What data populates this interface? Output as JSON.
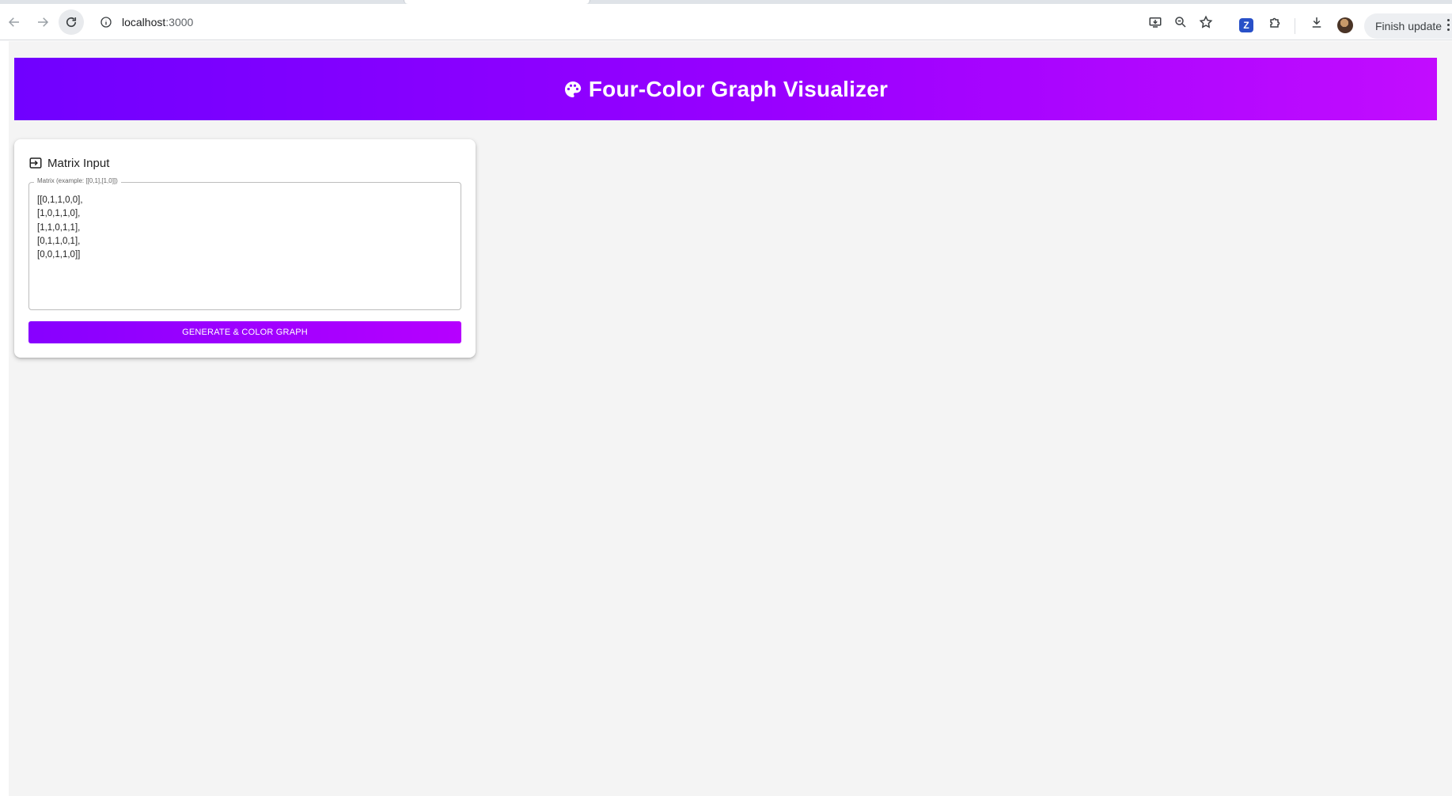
{
  "browser": {
    "url_host": "localhost",
    "url_port": ":3000",
    "finish_update_label": "Finish update"
  },
  "header": {
    "title": "Four-Color Graph Visualizer"
  },
  "matrix_card": {
    "title": "Matrix Input",
    "field_label": "Matrix (example: [[0,1],[1,0]])",
    "matrix_value": "[[0,1,1,0,0],\n[1,0,1,1,0],\n[1,1,0,1,1],\n[0,1,1,0,1],\n[0,0,1,1,0]]",
    "button_label": "GENERATE & COLOR GRAPH"
  },
  "colors": {
    "header_gradient_start": "#7000ff",
    "header_gradient_end": "#c20cff",
    "button_gradient_start": "#8700ff",
    "button_gradient_end": "#b600ff",
    "page_background": "#f4f4f4"
  },
  "icons": {
    "back": "arrow-left-icon",
    "forward": "arrow-right-icon",
    "reload": "reload-icon",
    "site_info": "info-icon",
    "install": "install-app-icon",
    "zoom": "zoom-icon",
    "bookmark": "star-icon",
    "extensions": "puzzle-icon",
    "download": "download-icon",
    "header": "palette-icon",
    "card": "input-icon"
  }
}
